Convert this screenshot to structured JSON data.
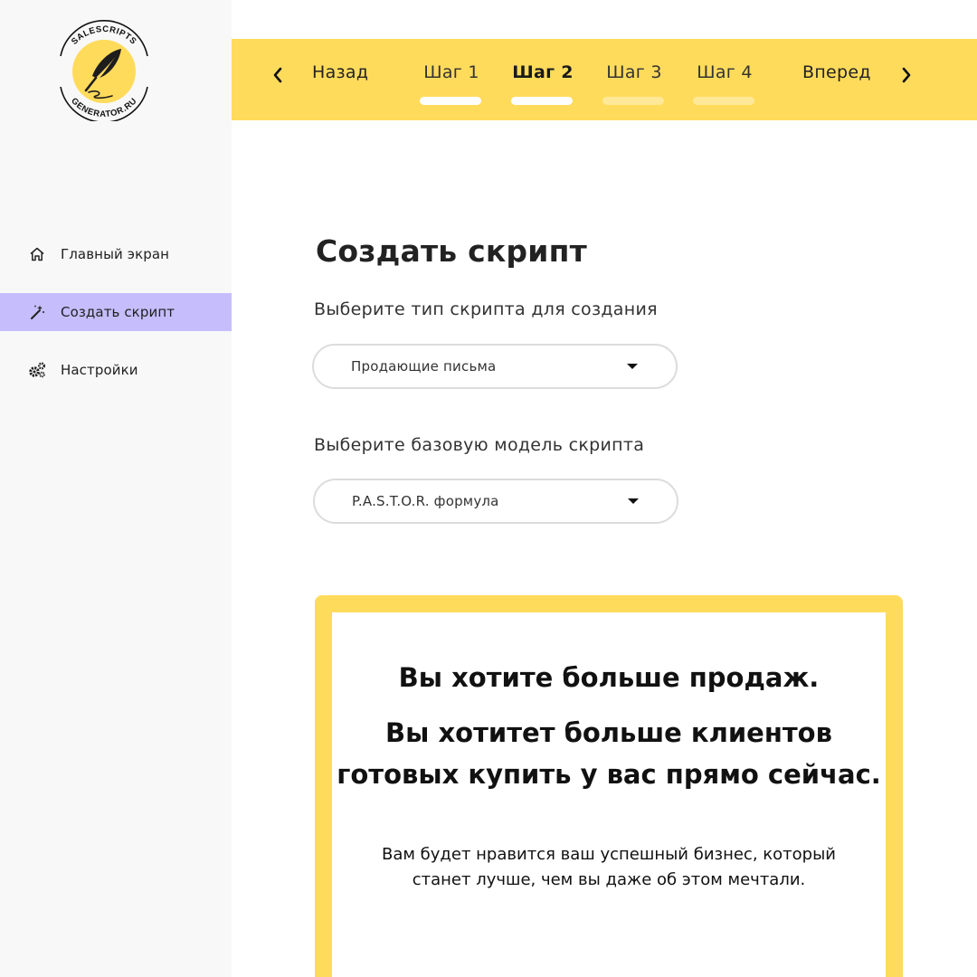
{
  "logo": {
    "top_text": "SALESCRIPTS",
    "bottom_text": "GENERATOR.RU",
    "icon": "feather-quill-icon"
  },
  "sidebar": {
    "items": [
      {
        "label": "Главный экран",
        "icon": "home-icon",
        "active": false
      },
      {
        "label": "Создать скрипт",
        "icon": "magic-wand-icon",
        "active": true
      },
      {
        "label": "Настройки",
        "icon": "gears-icon",
        "active": false
      }
    ]
  },
  "stepbar": {
    "back_label": "Назад",
    "forward_label": "Вперед",
    "steps": [
      {
        "label": "Шаг 1",
        "state": "done"
      },
      {
        "label": "Шаг 2",
        "state": "current"
      },
      {
        "label": "Шаг 3",
        "state": "pending"
      },
      {
        "label": "Шаг 4",
        "state": "pending"
      }
    ]
  },
  "main": {
    "title": "Создать скрипт",
    "script_type": {
      "label": "Выберите тип скрипта для создания",
      "value": "Продающие письма"
    },
    "base_model": {
      "label": "Выберите базовую модель скрипта",
      "value": "P.A.S.T.O.R. формула"
    }
  },
  "preview": {
    "headline_1": "Вы хотите больше продаж.",
    "headline_2_line_1": "Вы хотитет больше клиентов",
    "headline_2_line_2": "готовых купить у вас прямо сейчас.",
    "body_line_1": "Вам будет нравится ваш успешный бизнес, который",
    "body_line_2": "станет лучше, чем вы даже об этом мечтали."
  },
  "colors": {
    "accent_yellow": "#ffdb5c",
    "active_nav": "#c5bdfc",
    "sidebar_bg": "#f8f8f8"
  }
}
